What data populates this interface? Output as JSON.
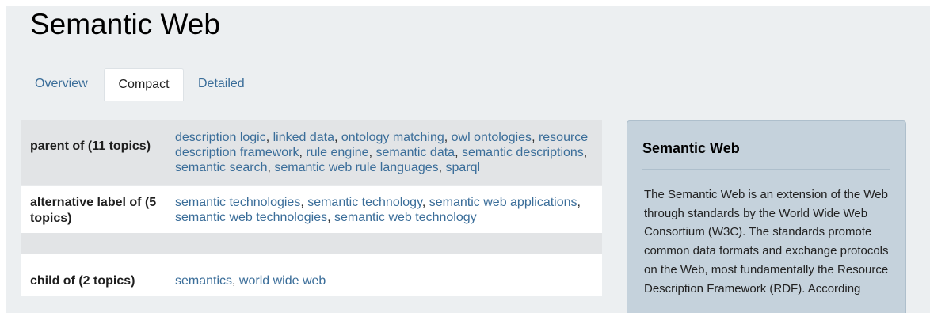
{
  "page": {
    "title": "Semantic Web"
  },
  "tabs": [
    {
      "label": "Overview",
      "active": false
    },
    {
      "label": "Compact",
      "active": true
    },
    {
      "label": "Detailed",
      "active": false
    }
  ],
  "relations": [
    {
      "label": "parent of (11 topics)",
      "topics": [
        "description logic",
        "linked data",
        "ontology matching",
        "owl ontologies",
        "resource description framework",
        "rule engine",
        "semantic data",
        "semantic descriptions",
        "semantic search",
        "semantic web rule languages",
        "sparql"
      ]
    },
    {
      "label": "alternative label of (5 topics)",
      "topics": [
        "semantic technologies",
        "semantic technology",
        "semantic web applications",
        "semantic web technologies",
        "semantic web technology"
      ]
    },
    {
      "label": "child of (2 topics)",
      "topics": [
        "semantics",
        "world wide web"
      ]
    }
  ],
  "info_panel": {
    "title": "Semantic Web",
    "text": "The Semantic Web is an extension of the Web through standards by the World Wide Web Consortium (W3C). The standards promote common data formats and exchange protocols on the Web, most fundamentally the Resource Description Framework (RDF). According"
  },
  "colors": {
    "link": "#3a6d99",
    "panel_bg": "#c5d2dc",
    "row_shade": "#e2e4e6",
    "page_bg": "#eceff1"
  }
}
